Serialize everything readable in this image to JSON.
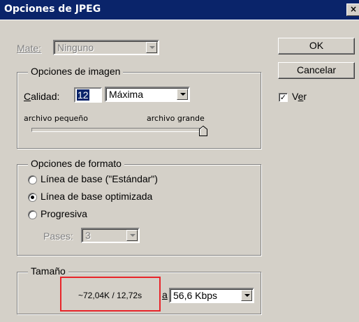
{
  "window": {
    "title": "Opciones de JPEG",
    "close_glyph": "×"
  },
  "matte": {
    "label": "Mate:",
    "value": "Ninguno"
  },
  "image_options": {
    "legend": "Opciones de imagen",
    "quality_label": "Calidad:",
    "quality_value": "12",
    "quality_preset": "Máxima",
    "small_file_label": "archivo pequeño",
    "large_file_label": "archivo grande",
    "slider_level": 1.0
  },
  "format_options": {
    "legend": "Opciones de formato",
    "options": [
      {
        "label": "Línea de base (\"Estándar\")",
        "selected": false
      },
      {
        "label": "Línea de base optimizada",
        "selected": true
      },
      {
        "label": "Progresiva",
        "selected": false
      }
    ],
    "scans_label": "Pases:",
    "scans_value": "3"
  },
  "size": {
    "legend": "Tamaño",
    "estimate": "~72,04K / 12,72s",
    "at_label": "a",
    "speed": "56,6 Kbps"
  },
  "buttons": {
    "ok": "OK",
    "cancel": "Cancelar"
  },
  "preview": {
    "label": "Ver",
    "checked": true,
    "check_glyph": "✓"
  },
  "colors": {
    "title_bar": "#0a246a",
    "dialog_bg": "#d4d0c8",
    "highlight": "#e8252a"
  }
}
